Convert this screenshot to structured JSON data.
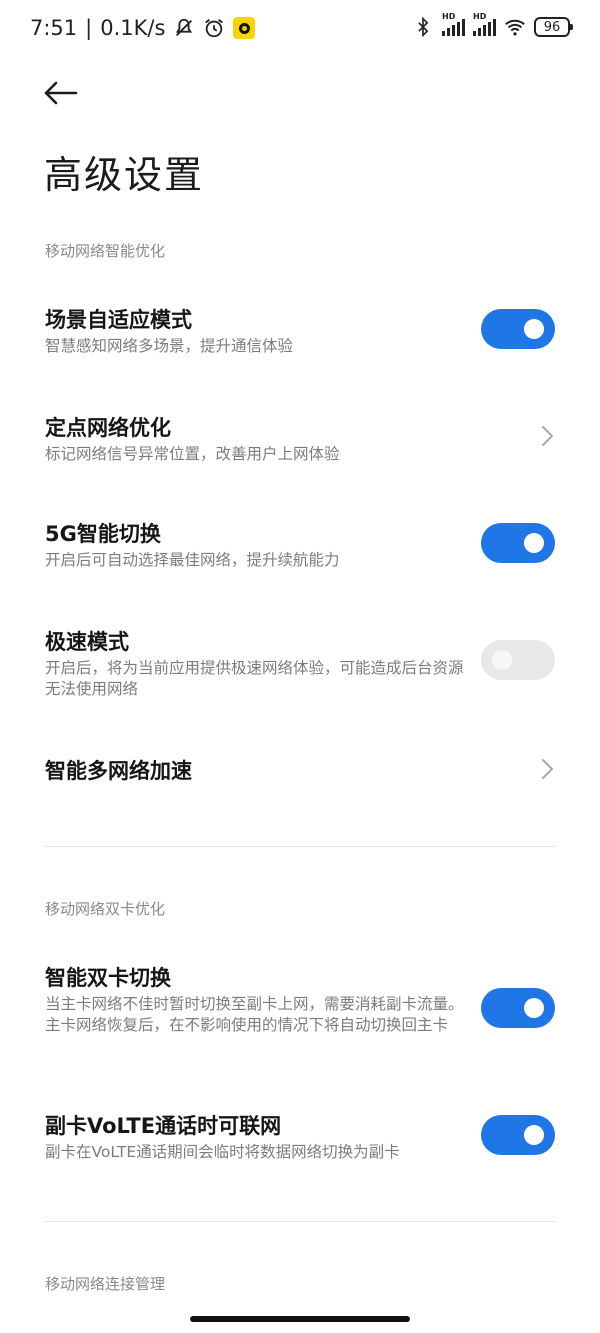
{
  "status_bar": {
    "time": "7:51",
    "separator": "|",
    "speed": "0.1K/s",
    "battery": "96",
    "icons": [
      "dnd-icon",
      "alarm-icon",
      "notification-icon",
      "bluetooth-icon",
      "signal-hd-icon",
      "signal-hd-icon",
      "wifi-icon",
      "battery-icon"
    ]
  },
  "header": {
    "back_icon": "back-arrow-icon",
    "title": "高级设置"
  },
  "sections": {
    "s1_header": "移动网络智能优化",
    "s2_header": "移动网络双卡优化",
    "s3_header": "移动网络连接管理"
  },
  "items": {
    "scene_adaptive": {
      "title": "场景自适应模式",
      "desc": "智慧感知网络多场景，提升通信体验",
      "state": "on"
    },
    "fixed_point": {
      "title": "定点网络优化",
      "desc": "标记网络信号异常位置，改善用户上网体验",
      "control": "chevron-right-icon"
    },
    "smart_5g": {
      "title": "5G智能切换",
      "desc": "开启后可自动选择最佳网络，提升续航能力",
      "state": "on"
    },
    "speed_mode": {
      "title": "极速模式",
      "desc": "开启后，将为当前应用提供极速网络体验，可能造成后台资源无法使用网络",
      "state": "off"
    },
    "multi_network": {
      "title": "智能多网络加速",
      "control": "chevron-right-icon"
    },
    "dual_sim": {
      "title": "智能双卡切换",
      "desc": "当主卡网络不佳时暂时切换至副卡上网，需要消耗副卡流量。主卡网络恢复后，在不影响使用的情况下将自动切换回主卡",
      "state": "on"
    },
    "volte_data": {
      "title": "副卡VoLTE通话时可联网",
      "desc": "副卡在VoLTE通话期间会临时将数据网络切换为副卡",
      "state": "on"
    }
  },
  "colors": {
    "toggle_on": "#1f77e6",
    "toggle_off": "#e8e8e8",
    "section_text": "#8a8a8a",
    "desc_text": "#7c7c7c"
  }
}
